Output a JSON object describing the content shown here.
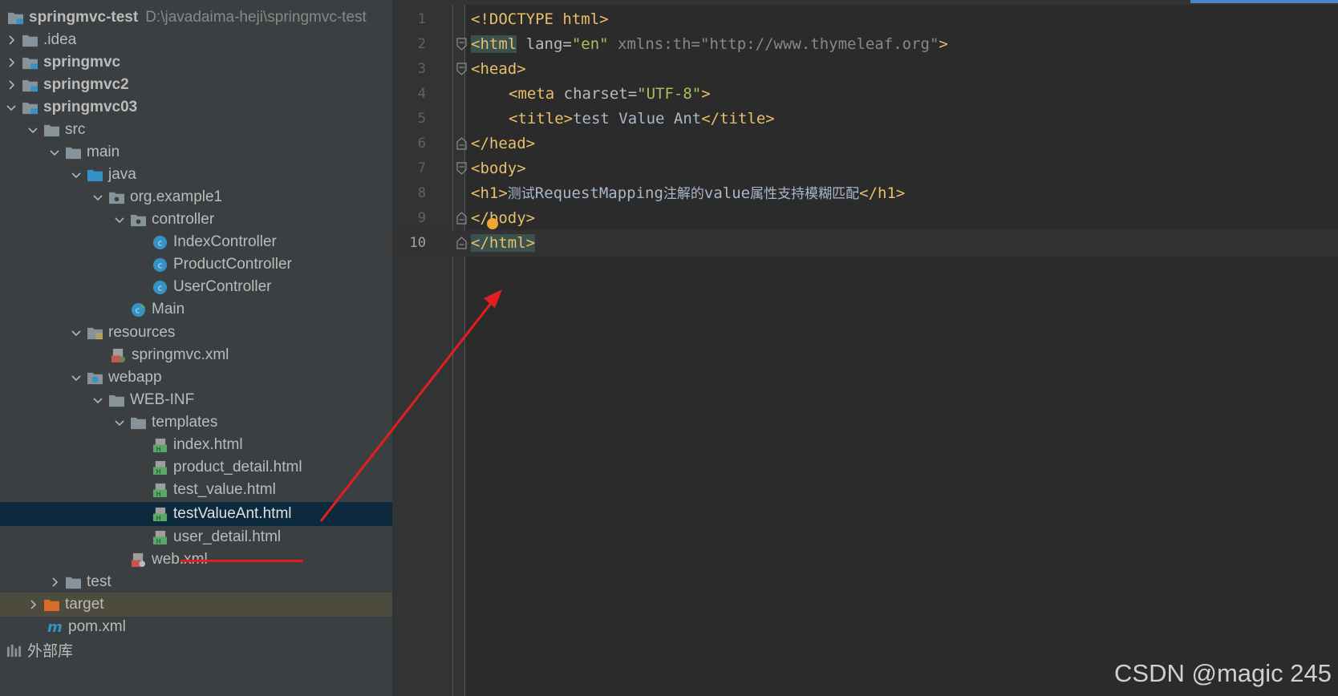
{
  "project": {
    "root_name": "springmvc-test",
    "root_path": "D:\\javadaima-heji\\springmvc-test",
    "items": [
      {
        "label": "springmvc-test"
      },
      {
        "label": ".idea"
      },
      {
        "label": "springmvc"
      },
      {
        "label": "springmvc2"
      },
      {
        "label": "springmvc03"
      },
      {
        "label": "src"
      },
      {
        "label": "main"
      },
      {
        "label": "java"
      },
      {
        "label": "org.example1"
      },
      {
        "label": "controller"
      },
      {
        "label": "IndexController"
      },
      {
        "label": "ProductController"
      },
      {
        "label": "UserController"
      },
      {
        "label": "Main"
      },
      {
        "label": "resources"
      },
      {
        "label": "springmvc.xml"
      },
      {
        "label": "webapp"
      },
      {
        "label": "WEB-INF"
      },
      {
        "label": "templates"
      },
      {
        "label": "index.html"
      },
      {
        "label": "product_detail.html"
      },
      {
        "label": "test_value.html"
      },
      {
        "label": "testValueAnt.html"
      },
      {
        "label": "user_detail.html"
      },
      {
        "label": "web.xml"
      },
      {
        "label": "test"
      },
      {
        "label": "target"
      },
      {
        "label": "pom.xml"
      },
      {
        "label": "外部库"
      }
    ]
  },
  "editor": {
    "line_numbers": [
      "1",
      "2",
      "3",
      "4",
      "5",
      "6",
      "7",
      "8",
      "9",
      "10"
    ],
    "current_line": "10",
    "tokens": {
      "l1": "<!DOCTYPE html>",
      "l2_tag": "<html",
      "l2_attr": " lang=",
      "l2_val": "\"en\"",
      "l2_ns": " xmlns:th=",
      "l2_nsval": "\"http://www.thymeleaf.org\"",
      "l2_close": ">",
      "l3": "<head>",
      "l4_tag": "<meta",
      "l4_attr": " charset=",
      "l4_val": "\"UTF-8\"",
      "l4_close": ">",
      "l5_open": "<title>",
      "l5_text": "test Value Ant",
      "l5_close": "</title>",
      "l6": "</head>",
      "l7": "<body>",
      "l8_open": "<h1>",
      "l8_text_a": "测试",
      "l8_text_b": "RequestMapping",
      "l8_text_c": "注解的",
      "l8_text_d": "value",
      "l8_text_e": "属性支持模糊匹配",
      "l8_close": "</h1>",
      "l9": "</body>",
      "l10": "</html>"
    }
  },
  "watermark": "CSDN @magic 245",
  "colors": {
    "tree_bg": "#3c3f41",
    "editor_bg": "#2b2b2b",
    "selection": "#0d293e",
    "tag": "#e8bf6a",
    "string": "#a5c25c",
    "annotation_red": "#e31e1e"
  }
}
